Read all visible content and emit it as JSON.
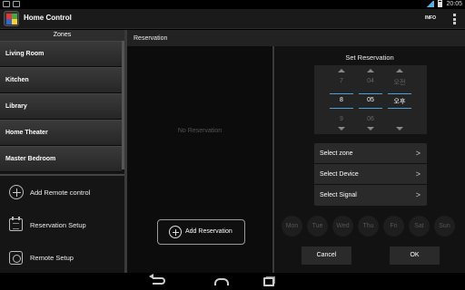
{
  "status_bar": {
    "time": "20:05"
  },
  "app": {
    "title": "Home Control",
    "info_label": "INFO"
  },
  "left": {
    "zones_header": "Zones",
    "zones": [
      "Living Room",
      "Kitchen",
      "Library",
      "Home Theater",
      "Master Bedroom"
    ],
    "actions": [
      "Add Remote control",
      "Reservation Setup",
      "Remote Setup"
    ]
  },
  "middle": {
    "header": "Reservation",
    "empty_text": "No Reservation",
    "add_button": "Add Reservation"
  },
  "right": {
    "title": "Set Reservation",
    "picker": {
      "hour": {
        "prev": "7",
        "current": "8",
        "next": "9"
      },
      "minute": {
        "prev": "04",
        "current": "05",
        "next": "06"
      },
      "ampm": {
        "prev": "오전",
        "current": "오후",
        "next": ""
      }
    },
    "select_rows": [
      "Select zone",
      "Select Device",
      "Select Signal"
    ],
    "days": [
      "Mon",
      "Tue",
      "Wed",
      "Thu",
      "Fri",
      "Sat",
      "Sun"
    ],
    "cancel_label": "Cancel",
    "ok_label": "OK"
  },
  "icons": {
    "back": "back-icon",
    "home": "home-icon",
    "recent": "recent-apps-icon",
    "overflow": "overflow-menu-icon",
    "add": "add-circle-icon",
    "calendar": "calendar-icon",
    "remote": "remote-icon"
  },
  "colors": {
    "accent": "#4aa3d8",
    "background": "#121212"
  }
}
